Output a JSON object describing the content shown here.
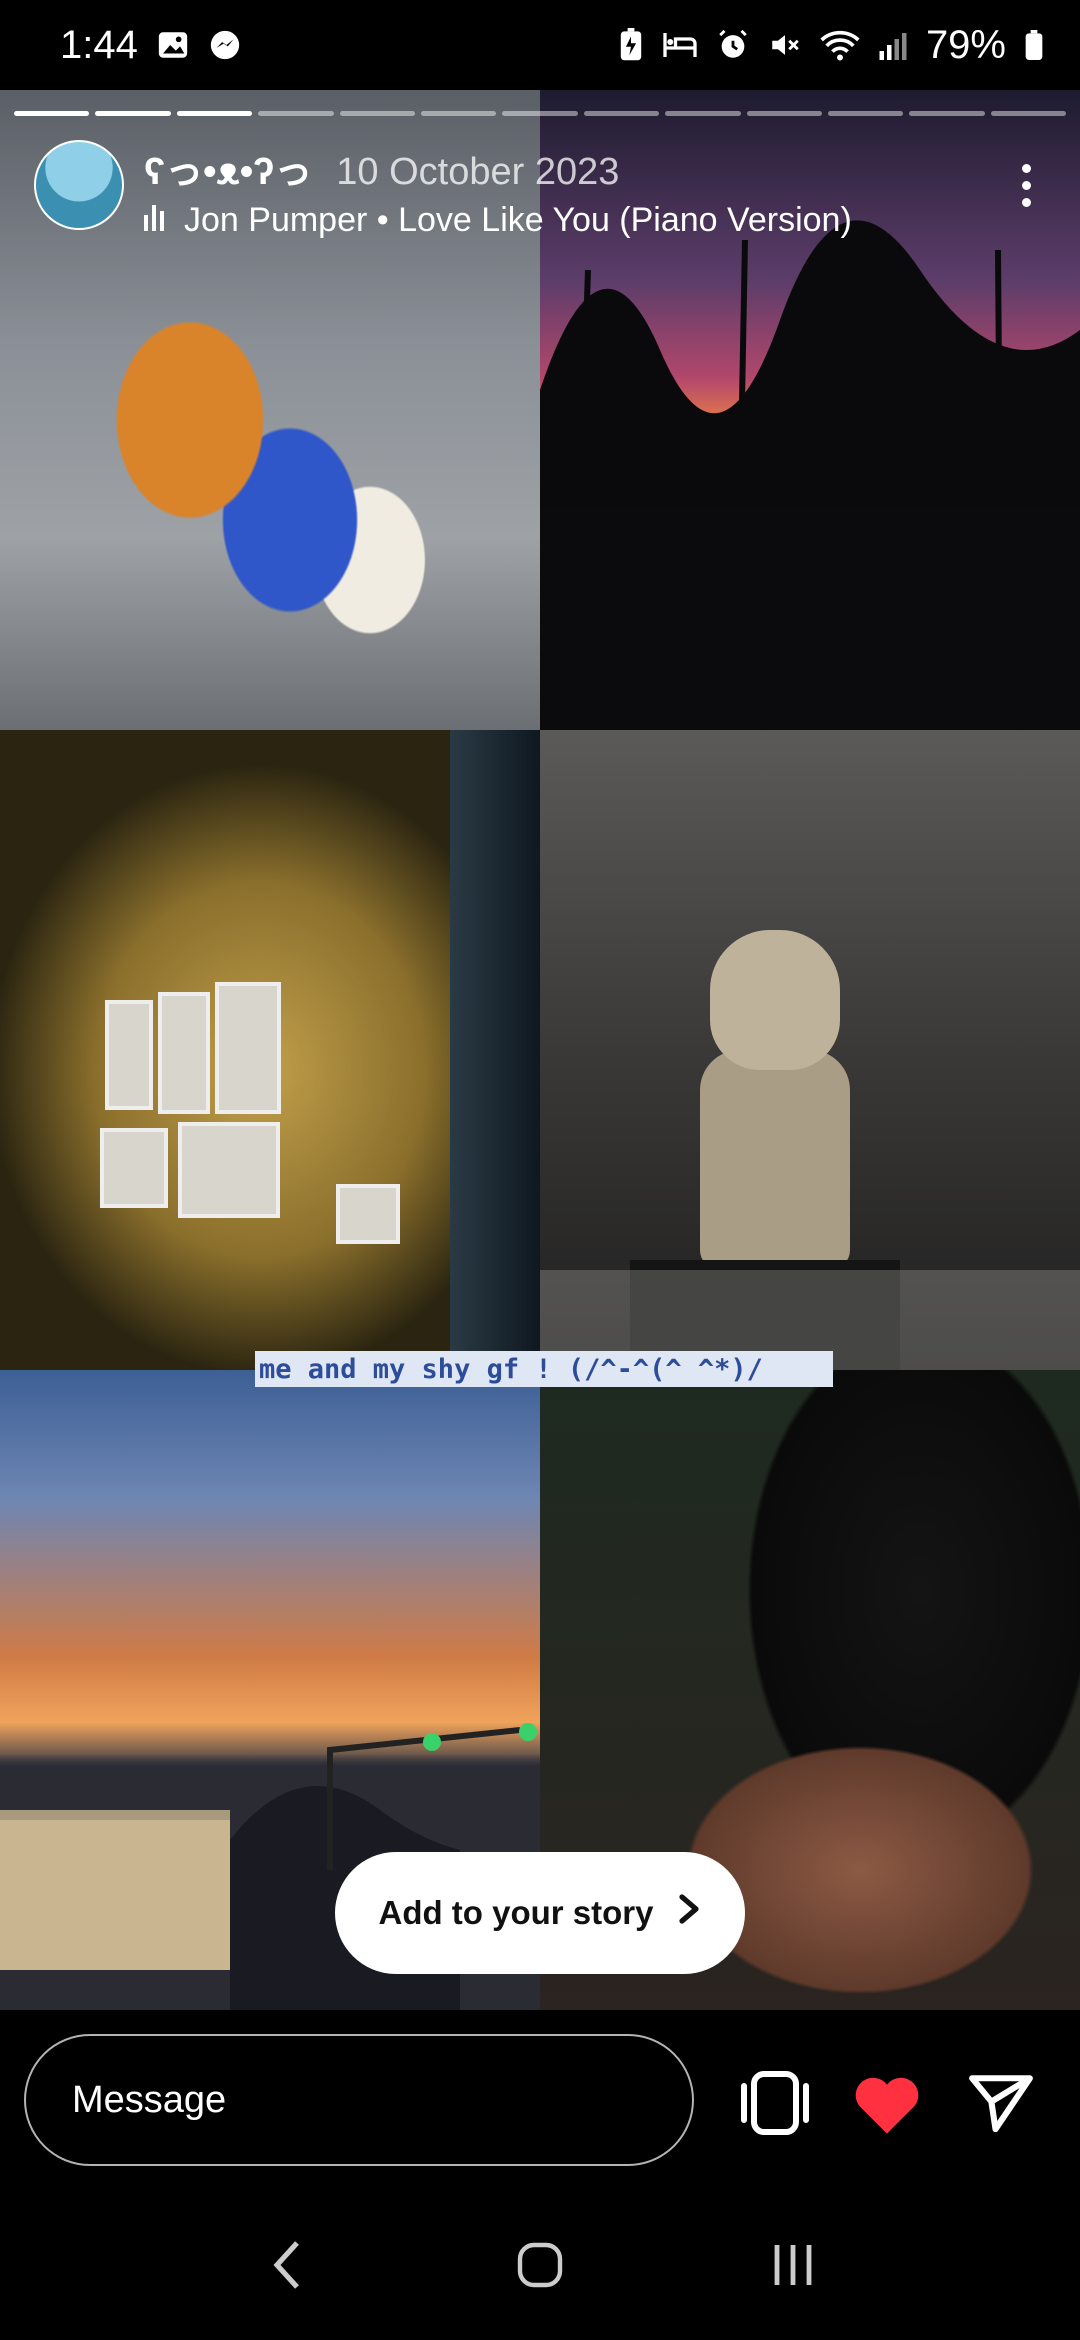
{
  "status_bar": {
    "time": "1:44",
    "battery_percent": "79%",
    "left_icons": [
      "gallery-icon",
      "messenger-icon"
    ],
    "right_icons": [
      "battery-saver-icon",
      "bed-icon",
      "alarm-icon",
      "mute-icon",
      "wifi-icon",
      "signal-icon",
      "battery-icon"
    ]
  },
  "story": {
    "progress": {
      "segments": 13,
      "current": 3
    },
    "username": "ʕっ•ᴥ•ʔっ",
    "date": "10 October 2023",
    "music": "Jon Pumper • Love Like You (Piano Version)",
    "caption": "me and my shy gf ! (/^-^(^ ^*)/",
    "add_to_story": "Add to your story"
  },
  "bottom_bar": {
    "message_placeholder": "Message"
  },
  "colors": {
    "like_heart": "#ff3040",
    "caption_bg": "#dfe6f4",
    "caption_text": "#2d4d9a"
  }
}
